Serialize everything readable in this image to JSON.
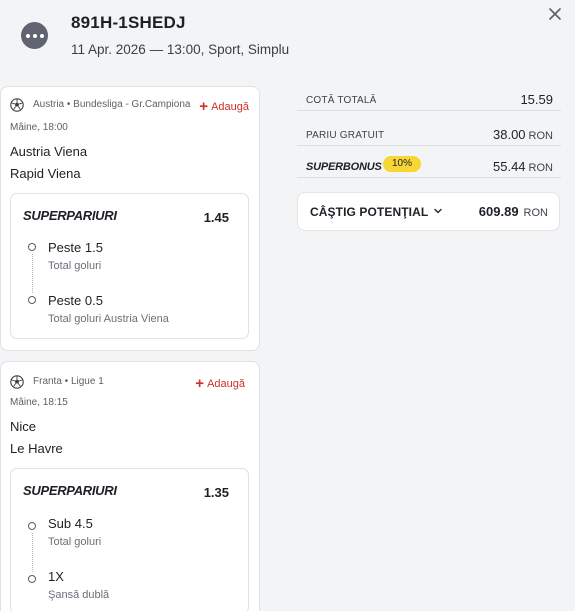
{
  "header": {
    "ticket_id": "891H-1SHEDJ",
    "meta": "11 Apr. 2026 — 13:00, Sport, Simplu",
    "menu_icon": "more-horizontal-icon",
    "close_icon": "close-icon"
  },
  "events": [
    {
      "sport_icon": "soccer-ball-icon",
      "league": "Austria • Bundesliga - Gr.Campiona",
      "add_label": "Adaugă",
      "time": "Mâine, 18:00",
      "home": "Austria Viena",
      "away": "Rapid Viena",
      "superpariuri": {
        "title": "SUPERPARIURI",
        "odd": "1.45",
        "legs": [
          {
            "name": "Peste 1.5",
            "market": "Total goluri"
          },
          {
            "name": "Peste 0.5",
            "market": "Total goluri Austria Viena"
          }
        ]
      }
    },
    {
      "sport_icon": "soccer-ball-icon",
      "league": "Franta • Ligue 1",
      "add_label": "Adaugă",
      "time": "Mâine, 18:15",
      "home": "Nice",
      "away": "Le Havre",
      "superpariuri": {
        "title": "SUPERPARIURI",
        "odd": "1.35",
        "legs": [
          {
            "name": "Sub 4.5",
            "market": "Total goluri"
          },
          {
            "name": "1X",
            "market": "Şansă dublă"
          }
        ]
      }
    }
  ],
  "summary": {
    "total_odds_label": "COTĂ TOTALĂ",
    "total_odds_value": "15.59",
    "free_bet_label": "PARIU GRATUIT",
    "free_bet_value": "38.00",
    "superbonus_label": "SUPERBONUS",
    "superbonus_percent": "10%",
    "superbonus_value": "55.44",
    "currency": "RON",
    "potential_label": "CÂŞTIG POTENŢIAL",
    "potential_value": "609.89"
  },
  "colors": {
    "accent_red": "#d22f27",
    "badge_yellow": "#f6d733",
    "background": "#f3f4f6"
  }
}
